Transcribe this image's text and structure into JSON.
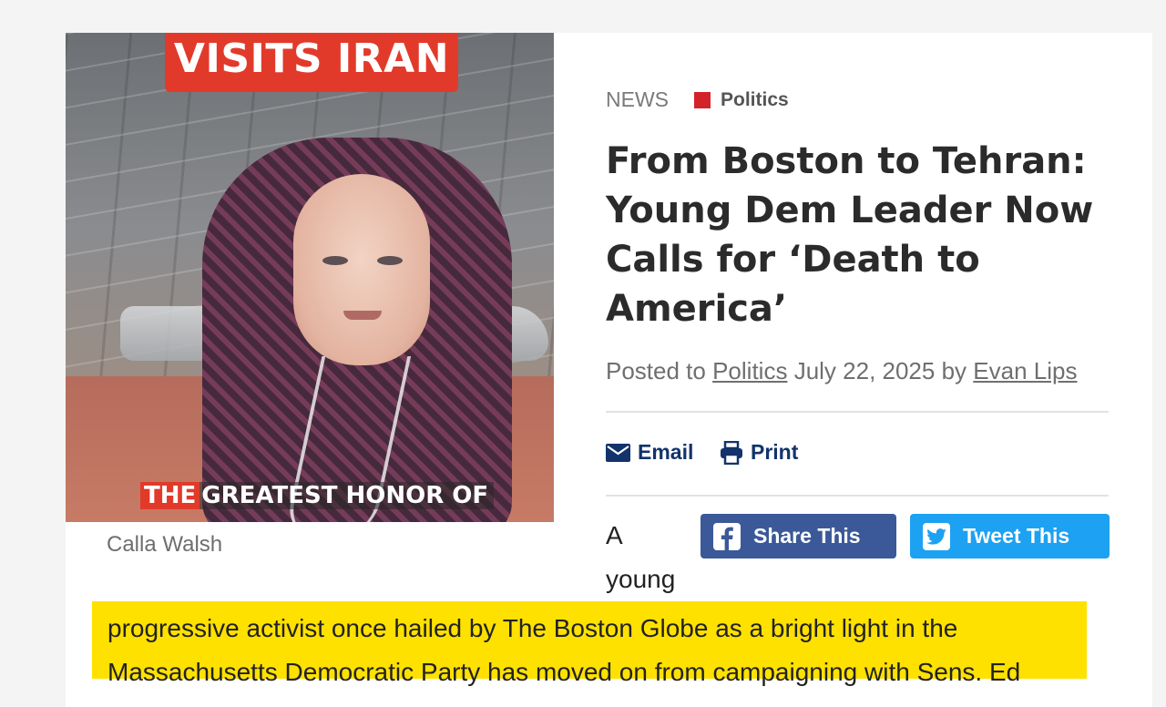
{
  "photo": {
    "top_banner": "VISITS IRAN",
    "caption_red": "THE",
    "caption_rest": "GREATEST HONOR OF",
    "credit": "Calla Walsh"
  },
  "article": {
    "section": "NEWS",
    "category": "Politics",
    "category_color": "#d2232a",
    "headline": "From Boston to Tehran: Young Dem Leader Now Calls for ‘Death to America’",
    "byline": {
      "prefix": "Posted to",
      "category_link": "Politics",
      "date": "July 22, 2025",
      "by": "by",
      "author": "Evan Lips"
    },
    "actions": {
      "email": "Email",
      "print": "Print"
    },
    "share": {
      "facebook": "Share This",
      "twitter": "Tweet This",
      "facebook_color": "#3b5998",
      "twitter_color": "#1da1f2"
    },
    "lead_words": [
      "A",
      "young"
    ],
    "body_highlight": "progressive activist once hailed by The Boston Globe as a bright light in the Massachusetts Democratic Party has moved on from campaigning with Sens. Ed"
  }
}
